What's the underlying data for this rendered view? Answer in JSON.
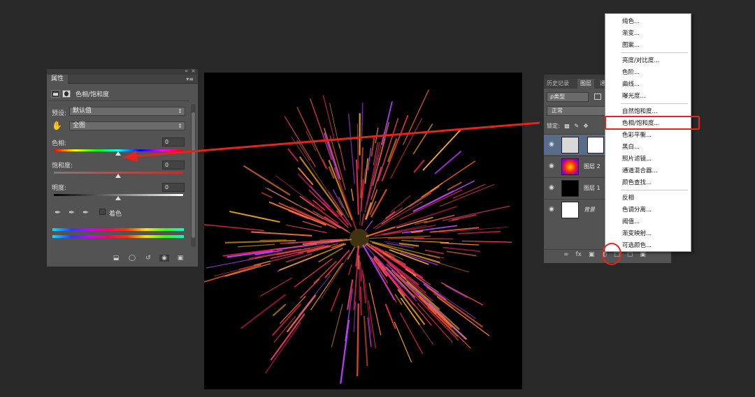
{
  "properties_panel": {
    "tab_label": "属性",
    "title": "色相/饱和度",
    "preset_label": "预设:",
    "preset_value": "默认值",
    "range_value": "全图",
    "hue_label": "色相:",
    "hue_value": "0",
    "saturation_label": "饱和度:",
    "saturation_value": "0",
    "lightness_label": "明度:",
    "lightness_value": "0",
    "colorize_label": "着色",
    "icons": [
      "adjustment-layer-icon",
      "mask-icon",
      "targeted-adjustment-hand-icon",
      "eyedropper-icon",
      "eyedropper-add-icon",
      "eyedropper-subtract-icon",
      "clip-to-layer-icon",
      "view-previous-icon",
      "reset-icon",
      "visibility-eye-icon",
      "trash-icon"
    ]
  },
  "layers_panel": {
    "tabs": [
      "历史记录",
      "图层",
      "通"
    ],
    "filter_type": "ρ类型",
    "blend_mode": "正常",
    "lock_label": "锁定:",
    "layers": [
      {
        "name": "",
        "selected": true
      },
      {
        "name": "图层 2",
        "selected": false
      },
      {
        "name": "图层 1",
        "selected": false
      },
      {
        "name": "背景",
        "selected": false
      }
    ],
    "bottom_icons": [
      "link-icon",
      "fx-icon",
      "add-mask-icon",
      "new-adjustment-layer-icon",
      "new-group-icon",
      "new-layer-icon",
      "trash-icon"
    ]
  },
  "adjustment_menu": {
    "highlighted_item": "色相/饱和度...",
    "groups": [
      [
        "纯色...",
        "渐变...",
        "图案..."
      ],
      [
        "亮度/对比度...",
        "色阶...",
        "曲线...",
        "曝光度..."
      ],
      [
        "自然饱和度...",
        "色相/饱和度...",
        "色彩平衡...",
        "黑白...",
        "照片滤镜...",
        "通道混合器...",
        "颜色查找..."
      ],
      [
        "反相",
        "色调分离...",
        "阈值...",
        "渐变映射...",
        "可选颜色..."
      ]
    ]
  },
  "colors": {
    "annotation_red": "#e8231c",
    "panel_bg": "#535353",
    "app_bg": "#282828",
    "selected_layer": "#596c8a"
  }
}
